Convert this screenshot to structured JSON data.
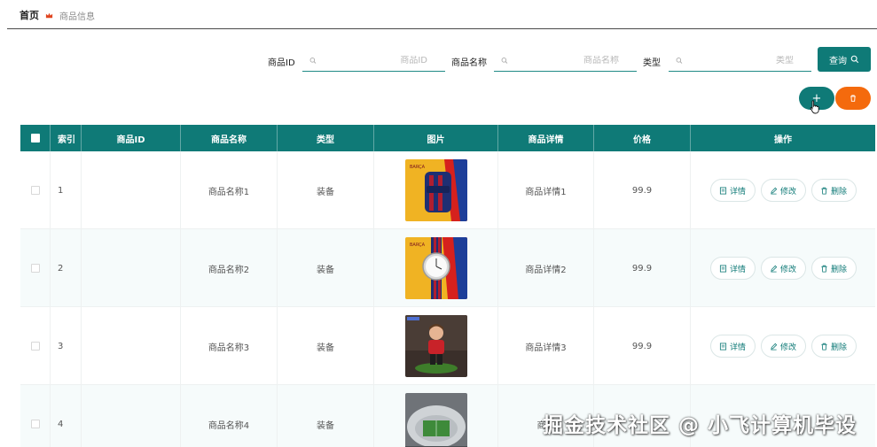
{
  "breadcrumb": {
    "home": "首页",
    "current": "商品信息"
  },
  "search": {
    "id_label": "商品ID",
    "id_placeholder": "商品ID",
    "name_label": "商品名称",
    "name_placeholder": "商品名称",
    "type_label": "类型",
    "type_placeholder": "类型",
    "query_label": "查询"
  },
  "toolbar": {
    "add_label": "+",
    "delete_icon": "trash-icon"
  },
  "table": {
    "headers": {
      "index": "索引",
      "id": "商品ID",
      "name": "商品名称",
      "type": "类型",
      "image": "图片",
      "detail": "商品详情",
      "price": "价格",
      "ops": "操作"
    },
    "actions": {
      "detail": "详情",
      "edit": "修改",
      "delete": "删除"
    },
    "rows": [
      {
        "index": "1",
        "id": "",
        "name": "商品名称1",
        "type": "装备",
        "detail": "商品详情1",
        "price": "99.9",
        "image": "backpack-product-image"
      },
      {
        "index": "2",
        "id": "",
        "name": "商品名称2",
        "type": "装备",
        "detail": "商品详情2",
        "price": "99.9",
        "image": "watch-product-image"
      },
      {
        "index": "3",
        "id": "",
        "name": "商品名称3",
        "type": "装备",
        "detail": "商品详情3",
        "price": "99.9",
        "image": "figure-product-image"
      },
      {
        "index": "4",
        "id": "",
        "name": "商品名称4",
        "type": "装备",
        "detail": "商品",
        "price": "",
        "image": "stadium-product-image"
      }
    ]
  },
  "watermark": "掘金技术社区 @ 小飞计算机毕设",
  "colors": {
    "primary": "#0f7a77",
    "danger": "#f46a0d",
    "header_text": "#ffffff"
  }
}
